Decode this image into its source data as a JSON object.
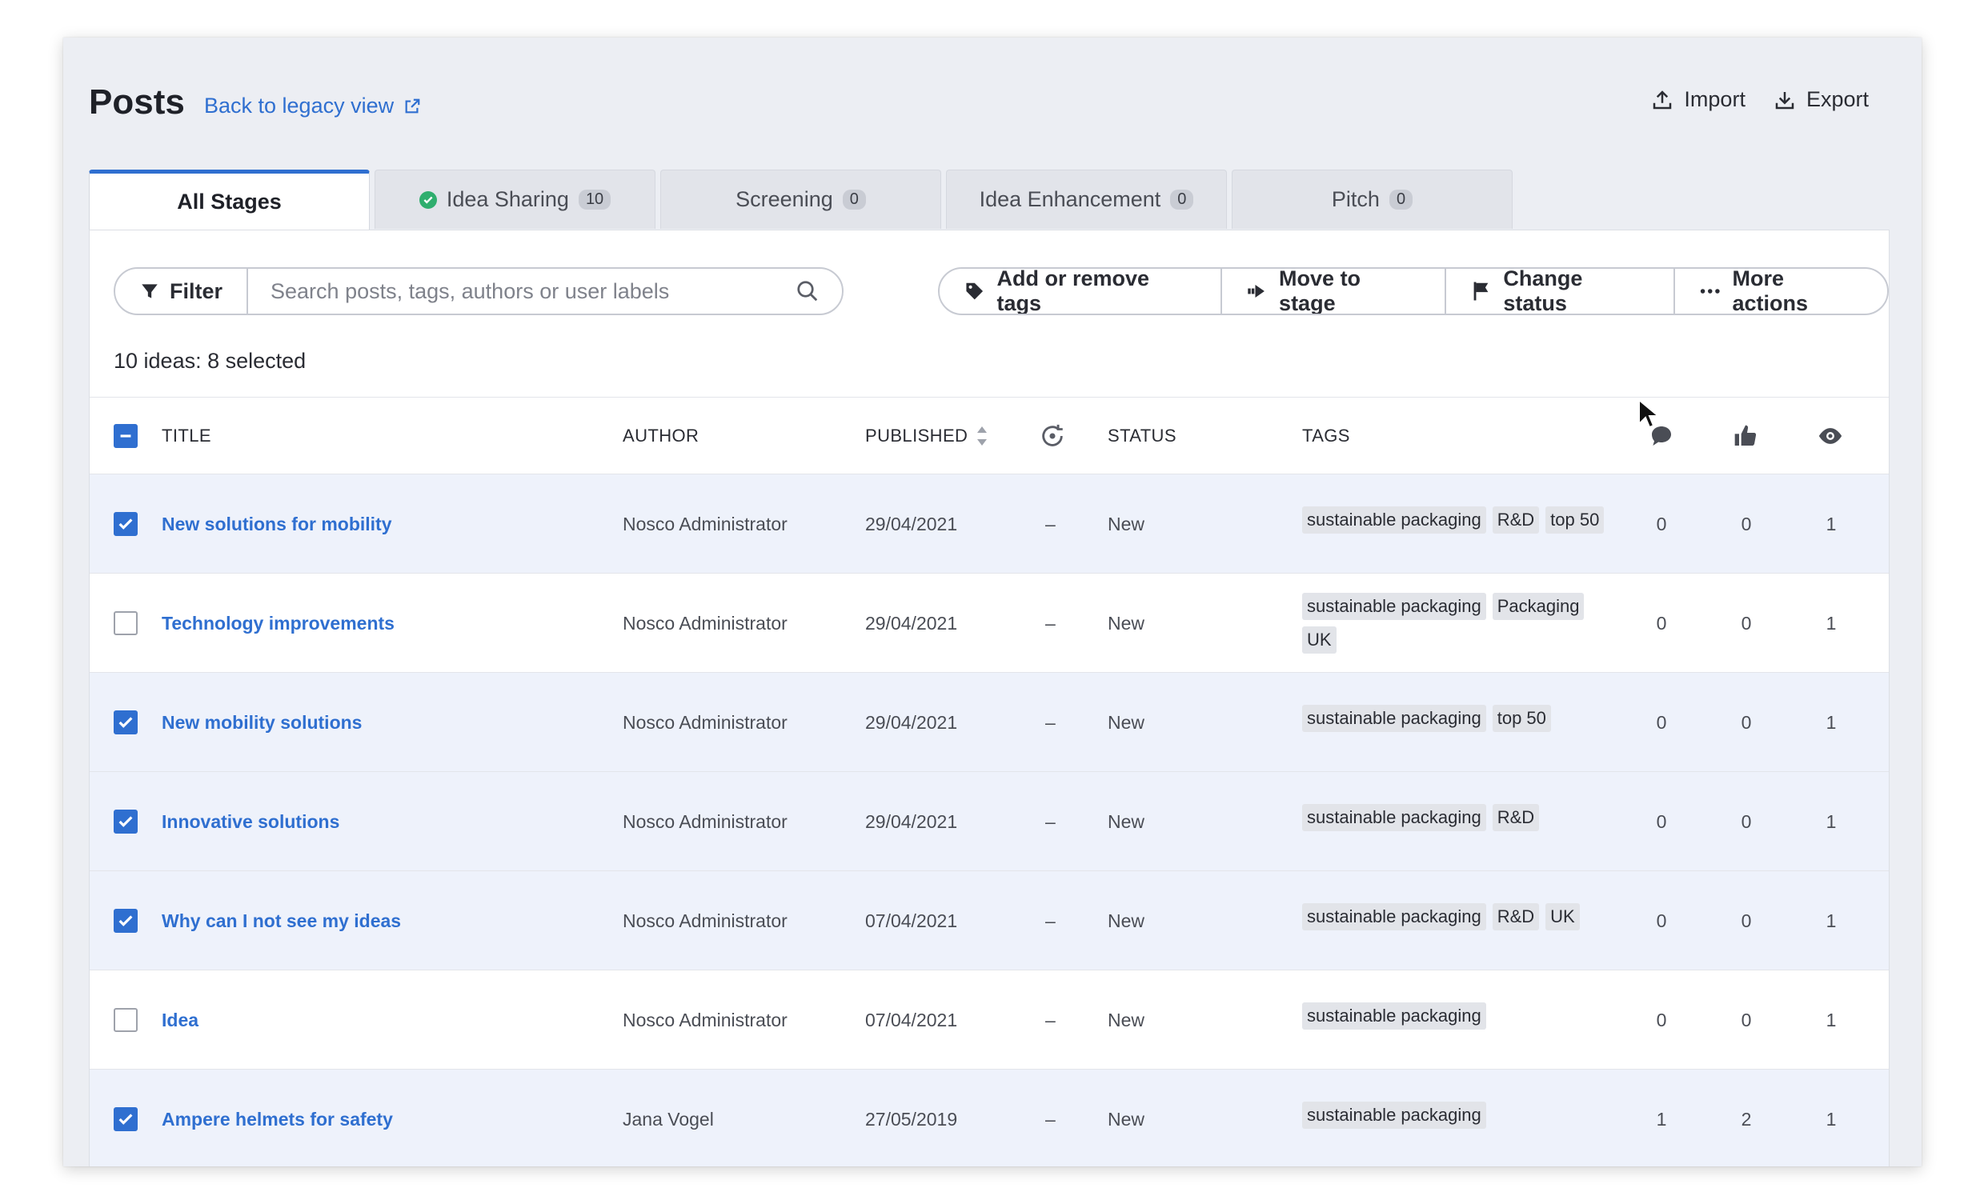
{
  "header": {
    "title": "Posts",
    "legacy_link": "Back to legacy view",
    "import_label": "Import",
    "export_label": "Export"
  },
  "tabs": [
    {
      "label": "All Stages",
      "count": ""
    },
    {
      "label": "Idea Sharing",
      "count": "10"
    },
    {
      "label": "Screening",
      "count": "0"
    },
    {
      "label": "Idea Enhancement",
      "count": "0"
    },
    {
      "label": "Pitch",
      "count": "0"
    }
  ],
  "toolbar": {
    "filter_label": "Filter",
    "search_placeholder": "Search posts, tags, authors or user labels",
    "add_tags_label": "Add or remove tags",
    "move_stage_label": "Move to stage",
    "change_status_label": "Change status",
    "more_actions_label": "More actions"
  },
  "summary": "10 ideas: 8 selected",
  "columns": {
    "title": "TITLE",
    "author": "AUTHOR",
    "published": "PUBLISHED",
    "status": "STATUS",
    "tags": "TAGS"
  },
  "rows": [
    {
      "title": "New solutions for mobility",
      "author": "Nosco Administrator",
      "published": "29/04/2021",
      "dash": "–",
      "status": "New",
      "tags": [
        "sustainable packaging",
        "R&D",
        "top 50"
      ],
      "comments": "0",
      "likes": "0",
      "views": "1"
    },
    {
      "title": "Technology improvements",
      "author": "Nosco Administrator",
      "published": "29/04/2021",
      "dash": "–",
      "status": "New",
      "tags": [
        "sustainable packaging",
        "Packaging",
        "UK"
      ],
      "comments": "0",
      "likes": "0",
      "views": "1"
    },
    {
      "title": "New mobility solutions",
      "author": "Nosco Administrator",
      "published": "29/04/2021",
      "dash": "–",
      "status": "New",
      "tags": [
        "sustainable packaging",
        "top 50"
      ],
      "comments": "0",
      "likes": "0",
      "views": "1"
    },
    {
      "title": "Innovative solutions",
      "author": "Nosco Administrator",
      "published": "29/04/2021",
      "dash": "–",
      "status": "New",
      "tags": [
        "sustainable packaging",
        "R&D"
      ],
      "comments": "0",
      "likes": "0",
      "views": "1"
    },
    {
      "title": "Why can I not see my ideas",
      "author": "Nosco Administrator",
      "published": "07/04/2021",
      "dash": "–",
      "status": "New",
      "tags": [
        "sustainable packaging",
        "R&D",
        "UK"
      ],
      "comments": "0",
      "likes": "0",
      "views": "1"
    },
    {
      "title": "Idea",
      "author": "Nosco Administrator",
      "published": "07/04/2021",
      "dash": "–",
      "status": "New",
      "tags": [
        "sustainable packaging"
      ],
      "comments": "0",
      "likes": "0",
      "views": "1"
    },
    {
      "title": "Ampere helmets for safety",
      "author": "Jana Vogel",
      "published": "27/05/2019",
      "dash": "–",
      "status": "New",
      "tags": [
        "sustainable packaging"
      ],
      "comments": "1",
      "likes": "2",
      "views": "1"
    }
  ],
  "row_selected": [
    true,
    false,
    true,
    true,
    true,
    false,
    true
  ],
  "colors": {
    "accent": "#2f6fd0",
    "selected_row": "#eef2fb",
    "status_dot": "#2fae6e"
  }
}
